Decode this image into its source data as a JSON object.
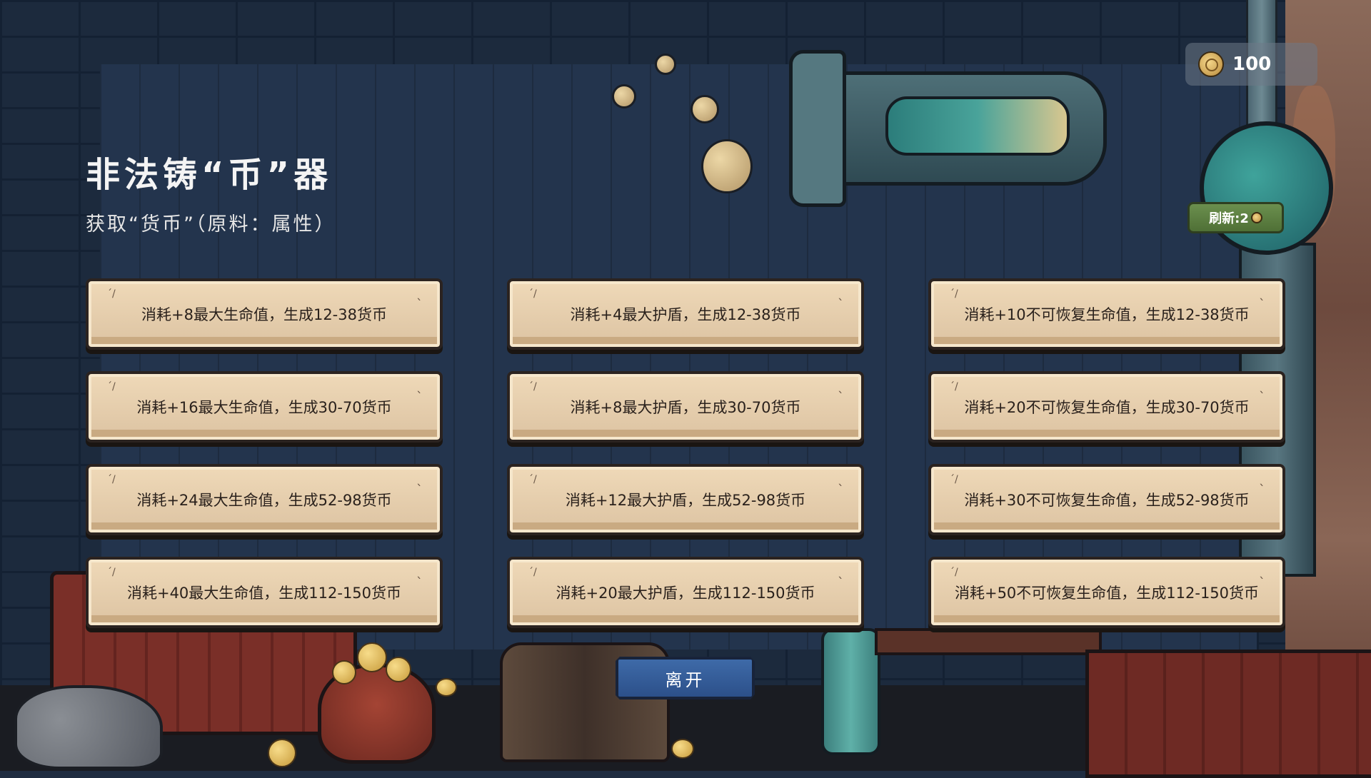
{
  "header": {
    "title": "非法铸“币”器",
    "subtitle": "获取“货币”（原料：属性）"
  },
  "currency": {
    "icon": "coin-icon",
    "value": "100"
  },
  "refresh": {
    "label": "刷新:2",
    "icon": "coin-icon"
  },
  "options": [
    "消耗+8最大生命值，生成12-38货币",
    "消耗+4最大护盾，生成12-38货币",
    "消耗+10不可恢复生命值，生成12-38货币",
    "消耗+16最大生命值，生成30-70货币",
    "消耗+8最大护盾，生成30-70货币",
    "消耗+20不可恢复生命值，生成30-70货币",
    "消耗+24最大生命值，生成52-98货币",
    "消耗+12最大护盾，生成52-98货币",
    "消耗+30不可恢复生命值，生成52-98货币",
    "消耗+40最大生命值，生成112-150货币",
    "消耗+20最大护盾，生成112-150货币",
    "消耗+50不可恢复生命值，生成112-150货币"
  ],
  "leave_label": "离开",
  "colors": {
    "background": "#1f2c40",
    "option_card": "#e6cfae",
    "leave_button": "#345c98",
    "refresh_button": "#5c7f42"
  }
}
